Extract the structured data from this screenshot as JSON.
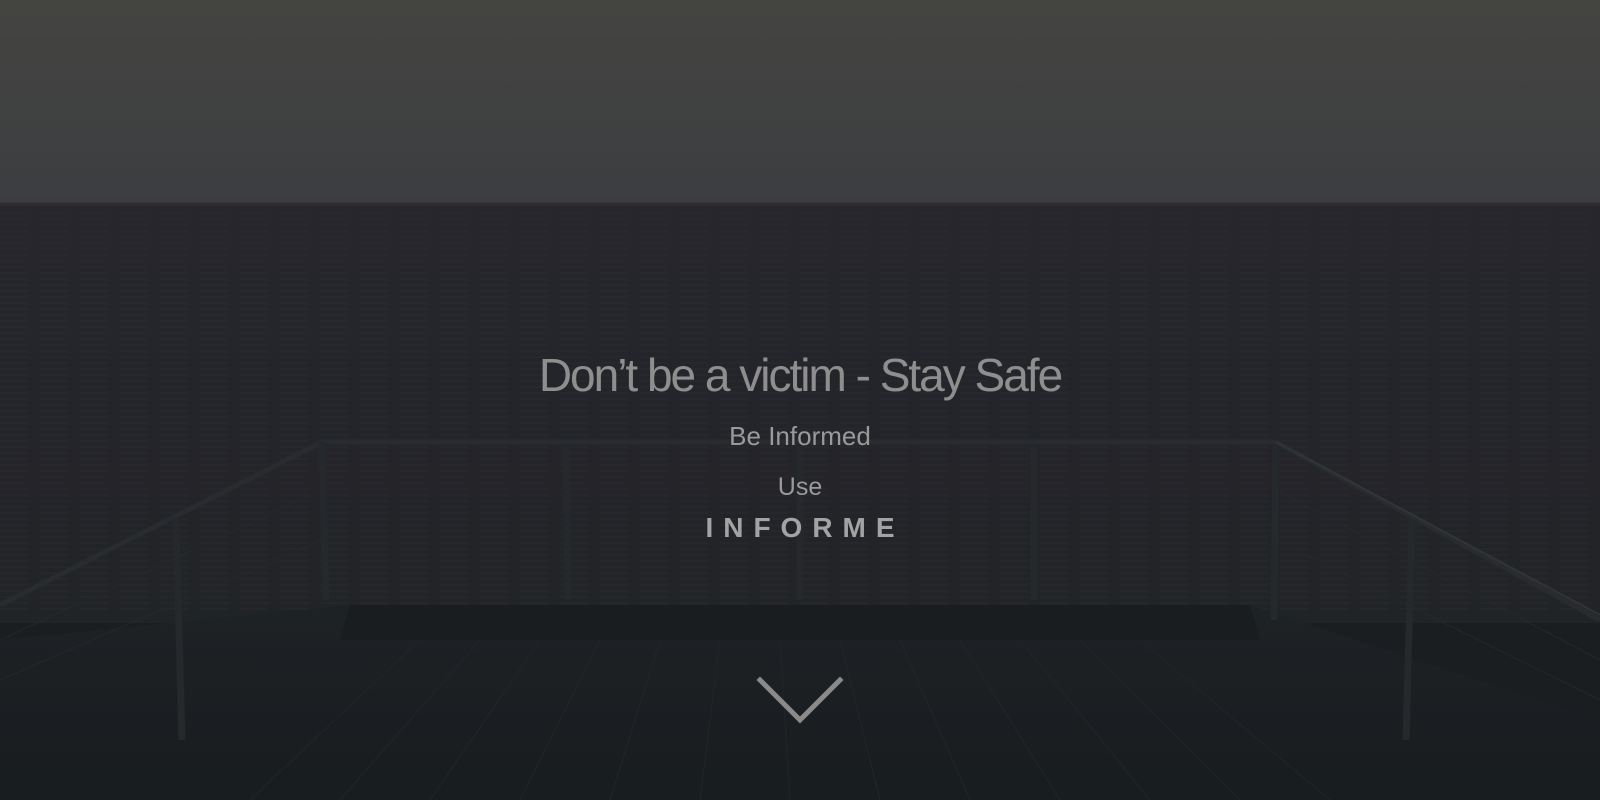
{
  "hero": {
    "headline": "Don’t be a victim - Stay  Safe",
    "subheading": "Be Informed",
    "use_label": "Use",
    "brand_name": "INFORME"
  },
  "icons": {
    "scroll_down": "chevron-down-icon"
  },
  "colors": {
    "sky": "#4b4c47",
    "sea": "#2a2c33",
    "deck": "#1f2326",
    "text": "#8e8e8e"
  }
}
